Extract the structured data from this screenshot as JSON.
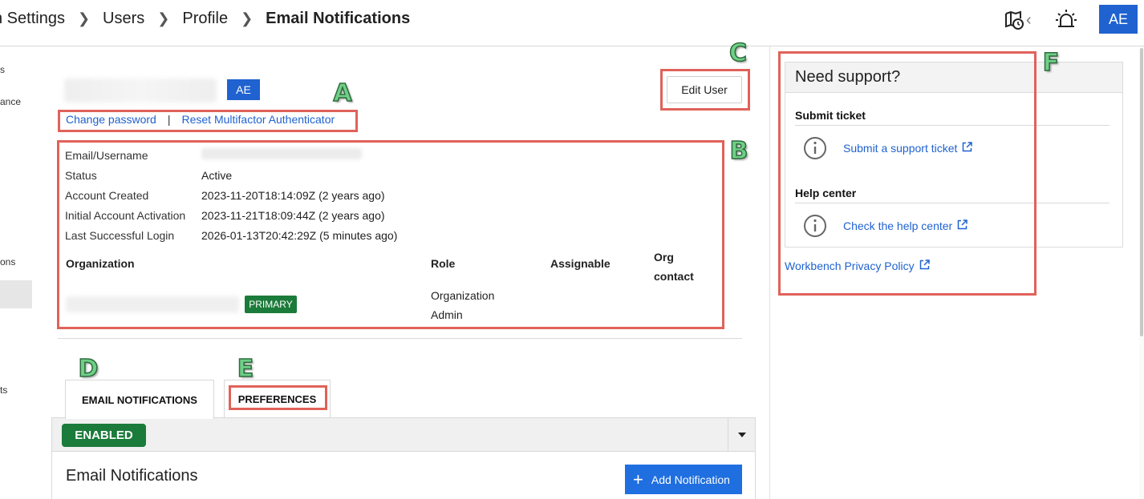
{
  "breadcrumb": {
    "items": [
      "n Settings",
      "Users",
      "Profile"
    ],
    "current": "Email Notifications"
  },
  "header": {
    "avatar": "AE",
    "icons": [
      "map-clock-icon",
      "chevron-left-icon",
      "alarm-light-icon"
    ]
  },
  "sidenav": {
    "items": [
      "s",
      "ance",
      "ons",
      "ts"
    ]
  },
  "user": {
    "avatar_badge": "AE",
    "change_password": "Change password",
    "link_separator": "|",
    "reset_mfa": "Reset Multifactor Authenticator",
    "edit_button": "Edit User"
  },
  "details": {
    "rows": [
      {
        "label": "Email/Username",
        "value": ""
      },
      {
        "label": "Status",
        "value": "Active"
      },
      {
        "label": "Account Created",
        "value": "2023-11-20T18:14:09Z (2 years ago)"
      },
      {
        "label": "Initial Account Activation",
        "value": "2023-11-21T18:09:44Z (2 years ago)"
      },
      {
        "label": "Last Successful Login",
        "value": "2026-01-13T20:42:29Z (5 minutes ago)"
      }
    ]
  },
  "organizations": {
    "headers": {
      "organization": "Organization",
      "role": "Role",
      "assignable": "Assignable",
      "org_contact": "Org contact"
    },
    "rows": [
      {
        "primary_badge": "PRIMARY",
        "role": "Organization Admin"
      }
    ]
  },
  "tabs": {
    "email_notifications": "EMAIL NOTIFICATIONS",
    "preferences": "PREFERENCES"
  },
  "panel": {
    "status": "ENABLED",
    "title": "Email Notifications",
    "add_button": "Add Notification"
  },
  "support": {
    "title": "Need support?",
    "submit_section": "Submit ticket",
    "submit_link": "Submit a support ticket",
    "help_section": "Help center",
    "help_link": "Check the help center",
    "privacy_link": "Workbench Privacy Policy"
  },
  "annotations": {
    "a": "A",
    "b": "B",
    "c": "C",
    "d": "D",
    "e": "E",
    "f": "F"
  },
  "colors": {
    "accent_blue": "#1f62d0",
    "success_green": "#1b7b3a",
    "annotation_red": "#e0625a",
    "annotation_green": "#6fcf87"
  }
}
